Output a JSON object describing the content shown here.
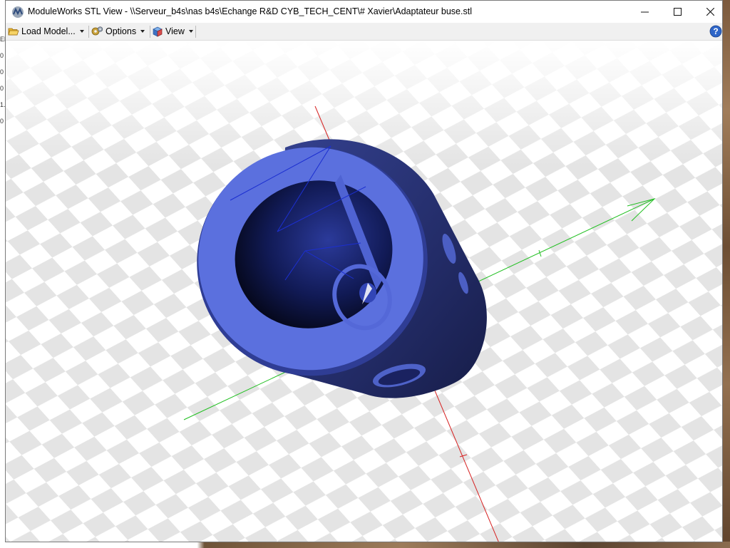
{
  "window": {
    "title": "ModuleWorks STL View - \\\\Serveur_b4s\\nas b4s\\Echange R&D CYB_TECH_CENT\\# Xavier\\Adaptateur buse.stl"
  },
  "controls": {
    "minimize": "—",
    "maximize": "☐",
    "close": "✕"
  },
  "toolbar": {
    "load_model_label": "Load Model...",
    "options_label": "Options",
    "view_label": "View",
    "help_label": "?"
  },
  "left_peek": {
    "lines": [
      "El",
      "0",
      "0",
      "0",
      "1.",
      "0"
    ]
  },
  "icons": {
    "app": "moduleworks-logo-icon",
    "load": "folder-open-icon",
    "options": "gears-icon",
    "view": "cube-view-icon",
    "help": "help-icon"
  },
  "colors": {
    "model_face": "#5b70de",
    "model_body": "#26306e",
    "axis_x": "#1fbf1f",
    "axis_z": "#d62020",
    "axis_y": "#1c2fd0",
    "floor_tile": "#e6e6e6"
  }
}
